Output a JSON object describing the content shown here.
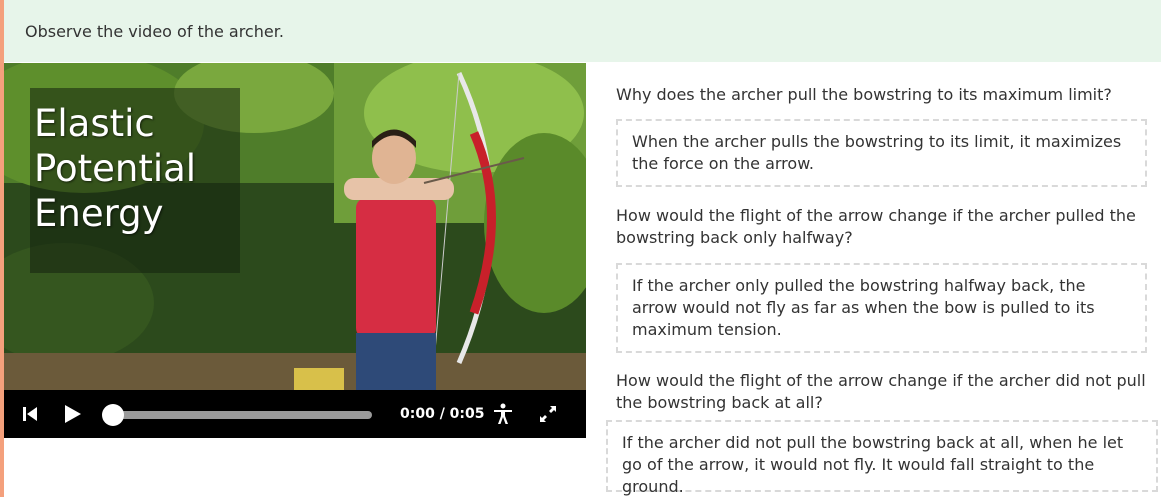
{
  "header": {
    "instruction": "Observe the video of the archer."
  },
  "video": {
    "title_lines": [
      "Elastic",
      "Potential",
      "Energy"
    ],
    "time": "0:00 / 0:05",
    "progress": 0
  },
  "questions": [
    {
      "question": "Why does the archer pull the bowstring to its maximum limit?",
      "answer": "When the archer pulls the bowstring to its limit, it maximizes the force on the arrow."
    },
    {
      "question": "How would the flight of the arrow change if the archer pulled the bowstring back only halfway?",
      "answer": "If the archer only pulled the bowstring halfway back, the arrow would not fly as far as when the bow is pulled to its maximum tension."
    },
    {
      "question": "How would the flight of the arrow change if the archer did not pull the bowstring back at all?",
      "answer": "If the archer did not pull the bowstring back at all, when he let go of the arrow, it would not fly. It would fall straight to the ground."
    }
  ]
}
